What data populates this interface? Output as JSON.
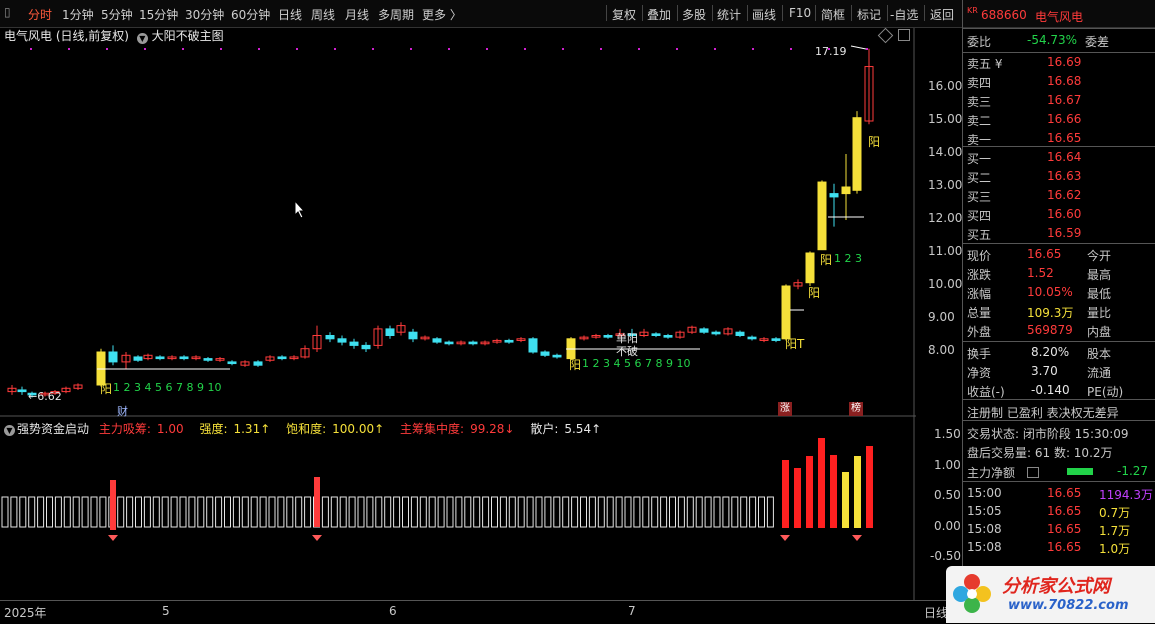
{
  "toolbar": {
    "periods": [
      "分时",
      "1分钟",
      "5分钟",
      "15分钟",
      "30分钟",
      "60分钟",
      "日线",
      "周线",
      "月线",
      "多周期",
      "更多 〉"
    ],
    "active_period": "分时",
    "tools": [
      "复权",
      "叠加",
      "多股",
      "统计",
      "画线",
      "F10",
      "简框",
      "标记",
      "-自选",
      "返回"
    ]
  },
  "chart": {
    "title": "电气风电 (日线,前复权)",
    "formula": "大阳不破主图",
    "high_label": "17.19",
    "low_label": "←6.62",
    "y_ticks": [
      "16.00",
      "15.00",
      "14.00",
      "13.00",
      "12.00",
      "11.00",
      "10.00",
      "9.00",
      "8.00"
    ],
    "annotations": {
      "yang": "阳",
      "count_seq": "1 2 3 4 5 6 7 8 9 10",
      "count_short": "1 2 3",
      "yangT": "阳T",
      "single_yang": "单阳",
      "not_broken": "不破",
      "cai": "财",
      "zhang": "涨",
      "bang": "榜"
    }
  },
  "indicator": {
    "name": "强势资金启动",
    "items": [
      {
        "label": "主力吸筹:",
        "value": "1.00",
        "color": "#ff3b3b"
      },
      {
        "label": "强度:",
        "value": "1.31↑",
        "color": "#f5e03a"
      },
      {
        "label": "饱和度:",
        "value": "100.00↑",
        "color": "#f5e03a"
      },
      {
        "label": "主筹集中度:",
        "value": "99.28↓",
        "color": "#ff3b3b"
      },
      {
        "label": "散户:",
        "value": "5.54↑",
        "color": "#ffffff"
      }
    ],
    "y_ticks": [
      "1.50",
      "1.00",
      "0.50",
      "0.00",
      "-0.50"
    ]
  },
  "axis": {
    "labels": [
      "2025年",
      "5",
      "6",
      "7"
    ],
    "period": "日线"
  },
  "quote": {
    "code": "688660",
    "name": "电气风电",
    "weibi_label": "委比",
    "weibi_value": "-54.73%",
    "weicha_label": "委差",
    "asks": [
      {
        "label": "卖五 ¥",
        "price": "16.69"
      },
      {
        "label": "卖四",
        "price": "16.68"
      },
      {
        "label": "卖三",
        "price": "16.67"
      },
      {
        "label": "卖二",
        "price": "16.66"
      },
      {
        "label": "卖一",
        "price": "16.65"
      }
    ],
    "bids": [
      {
        "label": "买一",
        "price": "16.64"
      },
      {
        "label": "买二",
        "price": "16.63"
      },
      {
        "label": "买三",
        "price": "16.62"
      },
      {
        "label": "买四",
        "price": "16.60"
      },
      {
        "label": "买五",
        "price": "16.59"
      }
    ],
    "stats": [
      {
        "label": "现价",
        "value": "16.65",
        "label2": "今开",
        "color": "#ff3b3b"
      },
      {
        "label": "涨跌",
        "value": "1.52",
        "label2": "最高",
        "color": "#ff3b3b"
      },
      {
        "label": "涨幅",
        "value": "10.05%",
        "label2": "最低",
        "color": "#ff3b3b"
      },
      {
        "label": "总量",
        "value": "109.3万",
        "label2": "量比",
        "color": "#f5e03a"
      },
      {
        "label": "外盘",
        "value": "569879",
        "label2": "内盘",
        "color": "#ff3b3b"
      }
    ],
    "stats2": [
      {
        "label": "换手",
        "value": "8.20%",
        "label2": "股本",
        "color": "#e6e6e6"
      },
      {
        "label": "净资",
        "value": "3.70",
        "label2": "流通",
        "color": "#e6e6e6"
      },
      {
        "label": "收益(-)",
        "value": "-0.140",
        "label2": "PE(动)",
        "color": "#e6e6e6"
      }
    ],
    "tags": "注册制 已盈利 表决权无差异",
    "trade_status": "交易状态: 闭市阶段 15:30:09",
    "after_hours": "盘后交易量: 61   数: 10.2万",
    "main_net_label": "主力净额",
    "main_net_value": "-1.27",
    "ticks": [
      {
        "time": "15:00",
        "price": "16.65",
        "vol": "1194.3万",
        "vol_color": "#c040ff"
      },
      {
        "time": "15:05",
        "price": "16.65",
        "vol": "0.7万",
        "vol_color": "#f5e03a"
      },
      {
        "time": "15:08",
        "price": "16.65",
        "vol": "1.7万",
        "vol_color": "#f5e03a"
      },
      {
        "time": "15:08",
        "price": "16.65",
        "vol": "1.0万",
        "vol_color": "#f5e03a"
      }
    ]
  },
  "logo": {
    "name": "分析家公式网",
    "url": "www.70822.com"
  },
  "colors": {
    "up": "#ff3b3b",
    "down": "#3fe0f0",
    "yang": "#f5e03a",
    "grid_dot": "#d020d0"
  }
}
